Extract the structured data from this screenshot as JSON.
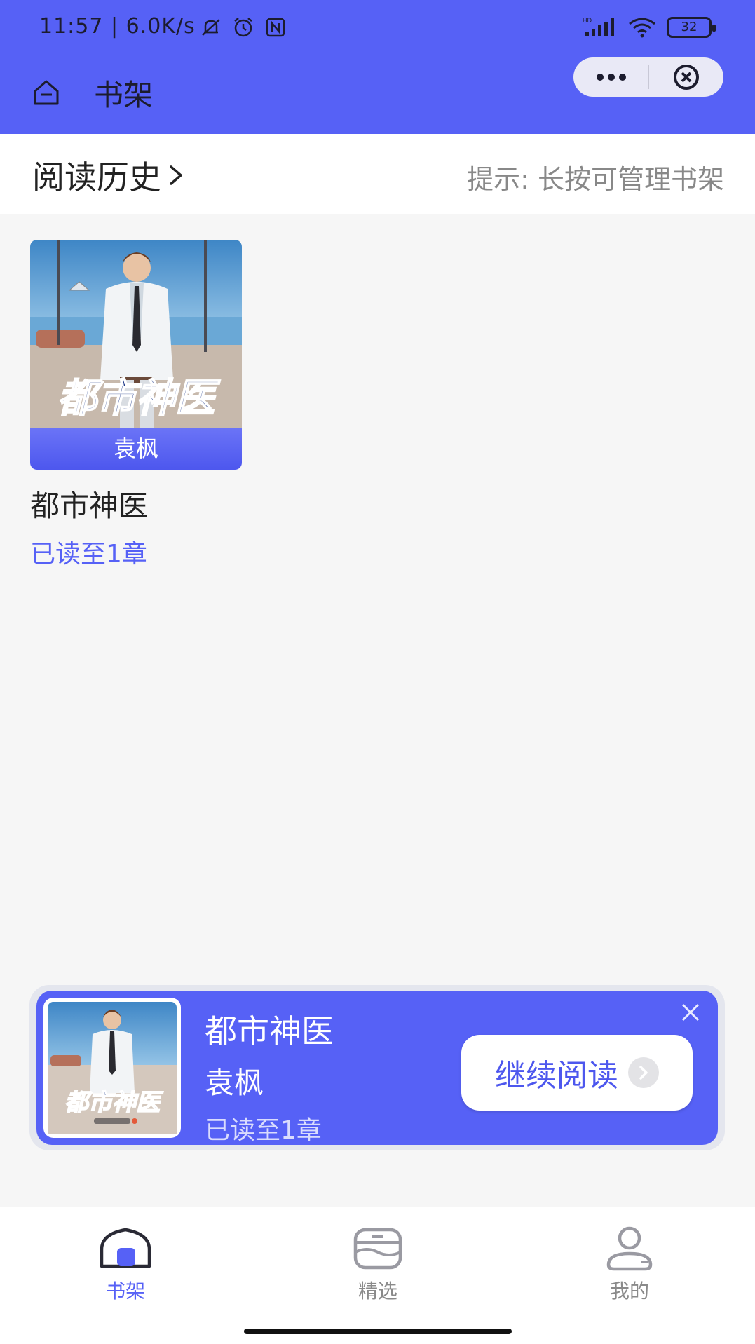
{
  "status_bar": {
    "time": "11:57 | 6.0K/s",
    "battery": "32",
    "signal_label": "HD"
  },
  "nav": {
    "title": "书架",
    "capsule_more_icon": "more-dots-icon",
    "capsule_close_icon": "close-circle-icon"
  },
  "history": {
    "link_label": "阅读历史",
    "hint": "提示: 长按可管理书架"
  },
  "bookshelf": {
    "books": [
      {
        "cover_title": "都市神医",
        "author": "袁枫",
        "title": "都市神医",
        "progress": "已读至1章"
      }
    ]
  },
  "continue_banner": {
    "cover_title": "都市神医",
    "title": "都市神医",
    "author": "袁枫",
    "progress": "已读至1章",
    "button_label": "继续阅读"
  },
  "tabbar": {
    "tabs": [
      {
        "label": "书架",
        "icon": "bookshelf-icon",
        "active": true
      },
      {
        "label": "精选",
        "icon": "featured-icon",
        "active": false
      },
      {
        "label": "我的",
        "icon": "profile-icon",
        "active": false
      }
    ]
  },
  "colors": {
    "primary": "#5661f6",
    "background": "#f6f6f6",
    "hint_text": "#888888"
  }
}
